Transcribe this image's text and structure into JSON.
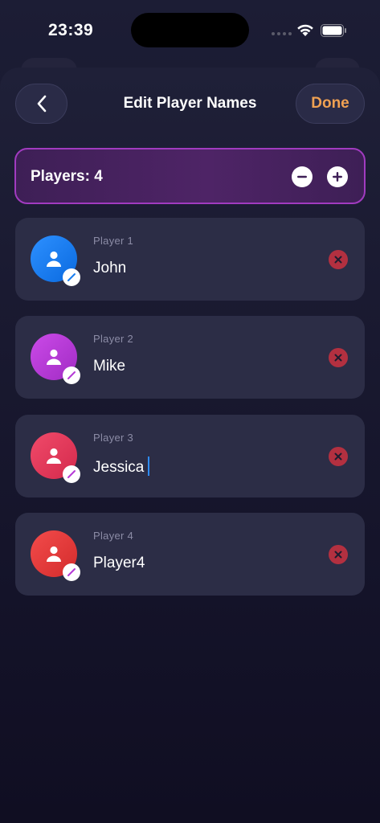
{
  "status_bar": {
    "time": "23:39"
  },
  "header": {
    "title": "Edit Player Names",
    "done_label": "Done"
  },
  "players_bar": {
    "label": "Players: 4",
    "count": 4
  },
  "players": [
    {
      "label": "Player 1",
      "name": "John",
      "avatar_color": "#1a7ef0"
    },
    {
      "label": "Player 2",
      "name": "Mike",
      "avatar_color": "#b53ad6"
    },
    {
      "label": "Player 3",
      "name": "Jessica",
      "avatar_color": "#e5355a"
    },
    {
      "label": "Player 4",
      "name": "Player4",
      "avatar_color": "#e53838"
    }
  ],
  "colors": {
    "accent": "#f0a152",
    "card": "#2c2d46",
    "remove": "#b33040",
    "caret": "#2f8cff"
  }
}
